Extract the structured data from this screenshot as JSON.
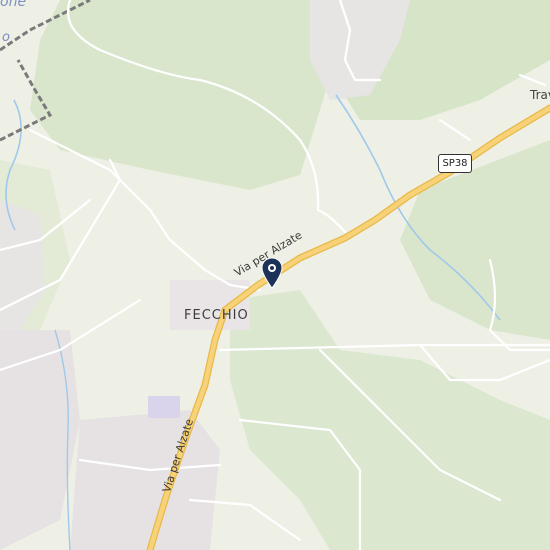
{
  "map": {
    "place_label": "FECCHIO",
    "route_badge": "SP38",
    "road_label_main": "Via per Alzate",
    "road_label_south": "Via per Alzate",
    "edge_label": "Trav",
    "corner_text_top": "one",
    "corner_text_left": "o",
    "marker": "location-pin-icon",
    "colors": {
      "land": "#eef0e6",
      "forest": "#d9e6cc",
      "road_major": "#f5c96a",
      "road_minor": "#ffffff",
      "water": "#9fc9ea",
      "built": "#e6e2e3",
      "railway": "#7a7a7a",
      "pin": "#1c3258"
    }
  }
}
